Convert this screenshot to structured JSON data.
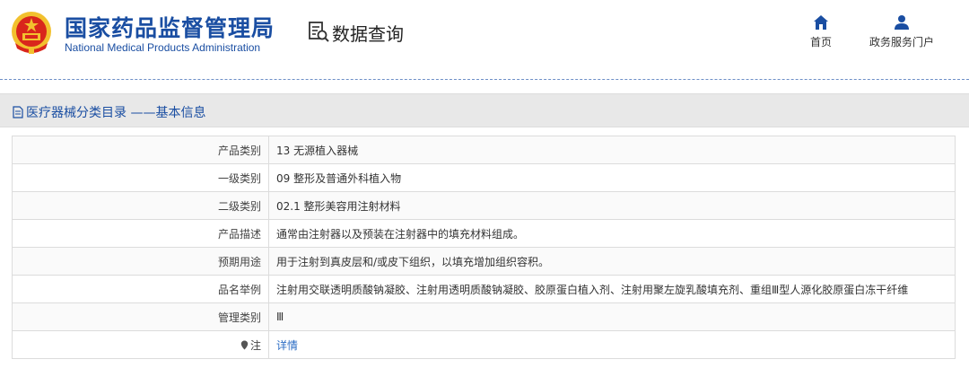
{
  "header": {
    "org_name_cn": "国家药品监督管理局",
    "org_name_en": "National Medical Products Administration",
    "page_title": "数据查询",
    "nav": [
      {
        "label": "首页",
        "icon": "home-icon"
      },
      {
        "label": "政务服务门户",
        "icon": "user-icon"
      }
    ]
  },
  "section": {
    "title": "医疗器械分类目录 ——基本信息",
    "icon": "document-icon"
  },
  "table": {
    "rows": [
      {
        "label": "产品类别",
        "value": "13 无源植入器械"
      },
      {
        "label": "一级类别",
        "value": "09 整形及普通外科植入物"
      },
      {
        "label": "二级类别",
        "value": "02.1 整形美容用注射材料"
      },
      {
        "label": "产品描述",
        "value": "通常由注射器以及预装在注射器中的填充材料组成。"
      },
      {
        "label": "预期用途",
        "value": "用于注射到真皮层和/或皮下组织，以填充增加组织容积。"
      },
      {
        "label": "品名举例",
        "value": "注射用交联透明质酸钠凝胶、注射用透明质酸钠凝胶、胶原蛋白植入剂、注射用聚左旋乳酸填充剂、重组Ⅲ型人源化胶原蛋白冻干纤维"
      },
      {
        "label": "管理类别",
        "value": "Ⅲ"
      }
    ],
    "note_label": "注",
    "note_link": "详情"
  },
  "colors": {
    "brand_blue": "#1a4ea2",
    "link_blue": "#2b6cc4",
    "emblem_red": "#d9261c",
    "emblem_gold": "#f2c12e"
  }
}
